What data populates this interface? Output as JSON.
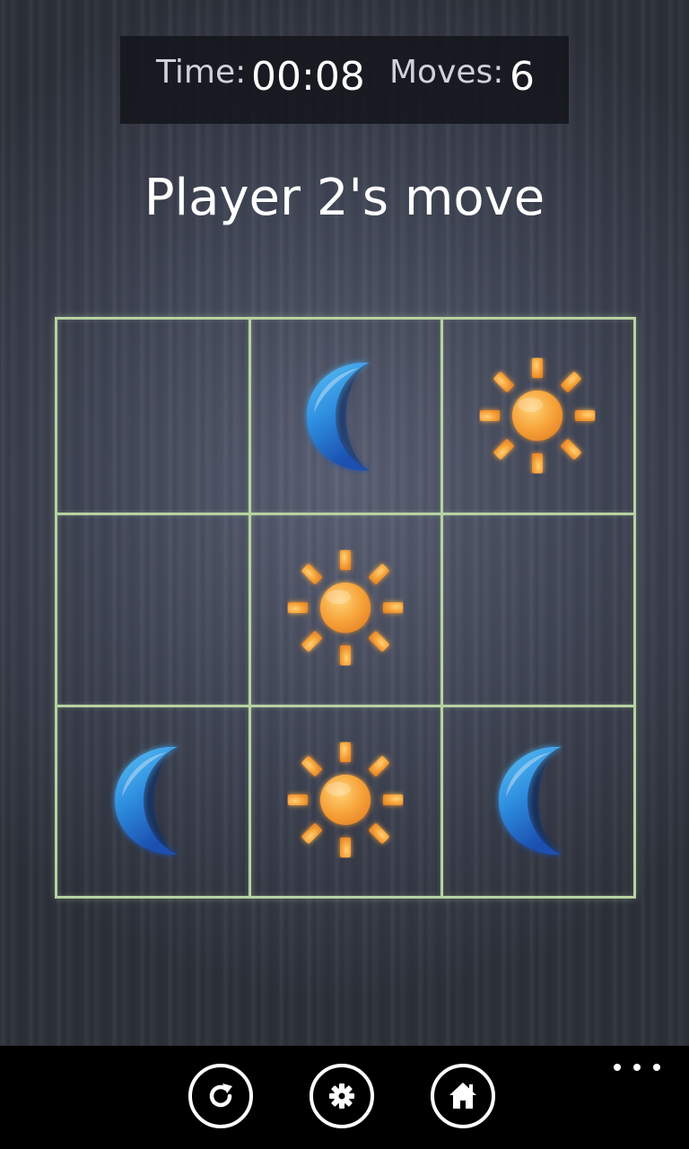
{
  "status": {
    "time_label": "Time:",
    "time_value": "00:08",
    "moves_label": "Moves:",
    "moves_value": "6"
  },
  "turn_text": "Player 2's move",
  "board": {
    "rows": 3,
    "cols": 3,
    "cells": [
      "",
      "moon",
      "sun",
      "",
      "sun",
      "",
      "moon",
      "sun",
      "moon"
    ]
  },
  "colors": {
    "grid_line": "#b7d2a2",
    "moon": "#2f8fe0",
    "sun": "#f7a43a"
  },
  "appbar": {
    "buttons": [
      "restart-icon",
      "gear-icon",
      "home-icon"
    ],
    "more_icon": "ellipsis-icon"
  }
}
